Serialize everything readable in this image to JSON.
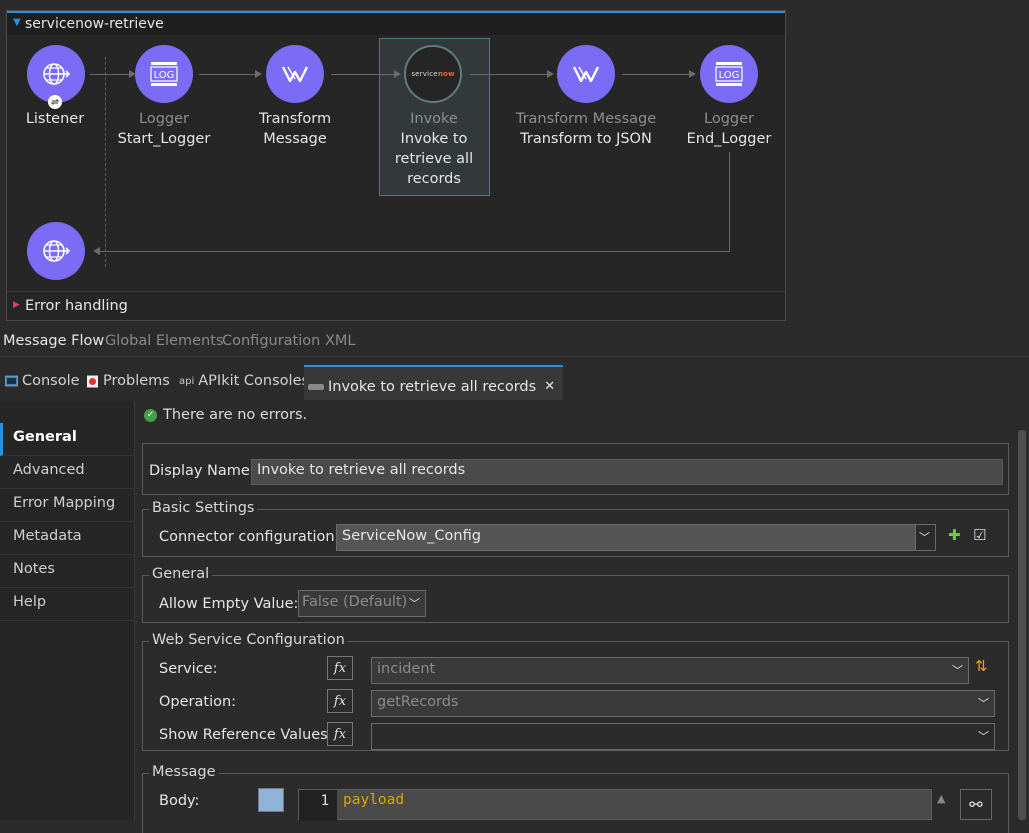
{
  "flow": {
    "name": "servicenow-retrieve",
    "nodes": [
      {
        "id": "listener",
        "line1": "Listener",
        "line2": ""
      },
      {
        "id": "logger-start",
        "line1": "Logger",
        "line2": "Start_Logger"
      },
      {
        "id": "transform-1",
        "line1": "Transform",
        "line2": "Message"
      },
      {
        "id": "invoke",
        "line1": "Invoke",
        "line2": "Invoke to retrieve all records"
      },
      {
        "id": "transform-2",
        "line1": "Transform Message",
        "line2": "Transform to JSON"
      },
      {
        "id": "logger-end",
        "line1": "Logger",
        "line2": "End_Logger"
      }
    ],
    "log_text": "LOG",
    "servicenow_logo": {
      "part1": "service",
      "part2": "now"
    },
    "error_handling": "Error handling"
  },
  "editor_tabs": [
    "Message Flow",
    "Global Elements",
    "Configuration XML"
  ],
  "view_tabs": {
    "console": "Console",
    "problems": "Problems",
    "apikit": "APIkit Consoles",
    "apikit_prefix": "api",
    "active": "Invoke to retrieve all records"
  },
  "side_nav": [
    "General",
    "Advanced",
    "Error Mapping",
    "Metadata",
    "Notes",
    "Help"
  ],
  "status": "There are no errors.",
  "form": {
    "display_name_label": "Display Name:",
    "display_name_value": "Invoke to retrieve all records",
    "basic_settings": "Basic Settings",
    "connector_label": "Connector configuration:",
    "connector_value": "ServiceNow_Config",
    "general": "General",
    "allow_empty_label": "Allow Empty Value:",
    "allow_empty_value": "False (Default)",
    "wsc": "Web Service Configuration",
    "service_label": "Service:",
    "service_value": "incident",
    "operation_label": "Operation:",
    "operation_value": "getRecords",
    "ref_label": "Show Reference Values:",
    "ref_value": "",
    "fx": "fx",
    "message": "Message",
    "body_label": "Body:",
    "code_line_no": "1",
    "code_text": "payload"
  },
  "colors": {
    "accent": "#2d8fd5",
    "node": "#7b6cf6",
    "code": "#d9a700",
    "ok": "#43a047"
  }
}
